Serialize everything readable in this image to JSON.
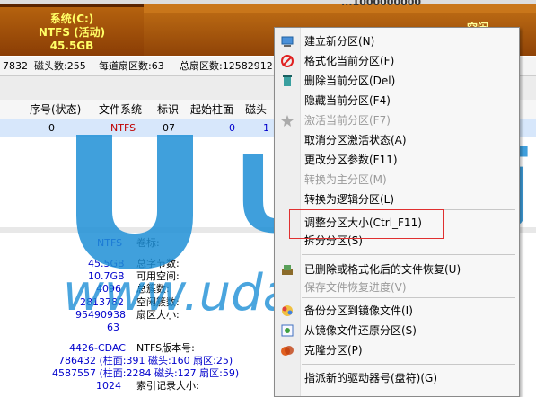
{
  "partition_bar": {
    "name": "系统(C:)",
    "fs": "NTFS (活动)",
    "size": "45.5GB",
    "second_label": "空闲"
  },
  "header_fragment": "...1000000000",
  "infobar": {
    "cyl_frag": "7832",
    "heads": "磁头数:255",
    "sectors_per_track": "每道扇区数:63",
    "total_sectors": "总扇区数:12582912"
  },
  "table": {
    "headers": [
      "序号(状态)",
      "文件系统",
      "标识",
      "起始柱面",
      "磁头"
    ],
    "row": {
      "index": "0",
      "fs": "NTFS",
      "id": "07",
      "start_cyl": "0",
      "head": "1"
    }
  },
  "details": {
    "fs_value": "NTFS",
    "fs_label": "卷标:",
    "total_size": "45.5GB",
    "total_bytes_label": "总字节数:",
    "free_space": "10.7GB",
    "free_label": "可用空间:",
    "cluster_size": "4096",
    "total_clusters_label": "总簇数:",
    "free_clusters": "2813782",
    "free_clusters_label": "空闲簇数:",
    "sector_count": "95490938",
    "sector_size_label": "扇区大小:",
    "sector_val": "63",
    "serial": "4426-CDAC",
    "ntfs_ver_label": "NTFS版本号:",
    "mft_pos": "786432 (柱面:391 磁头:160 扇区:25)",
    "mftmirr_pos": "4587557 (柱面:2284 磁头:127 扇区:59)",
    "last_frag": "1024",
    "index_label": "索引记录大小:"
  },
  "watermark_text": "U大师",
  "watermark_url": "www.udashi.com",
  "menu": {
    "items": [
      {
        "label": "建立新分区(N)",
        "icon": "new-partition-icon",
        "disabled": false
      },
      {
        "label": "格式化当前分区(F)",
        "icon": "format-icon",
        "disabled": false
      },
      {
        "label": "删除当前分区(Del)",
        "icon": "delete-icon",
        "disabled": false
      },
      {
        "label": "隐藏当前分区(F4)",
        "icon": "",
        "disabled": false
      },
      {
        "label": "激活当前分区(F7)",
        "icon": "activate-icon",
        "disabled": true
      },
      {
        "label": "取消分区激活状态(A)",
        "icon": "",
        "disabled": false
      },
      {
        "label": "更改分区参数(F11)",
        "icon": "",
        "disabled": false
      },
      {
        "label": "转换为主分区(M)",
        "icon": "",
        "disabled": true
      },
      {
        "label": "转换为逻辑分区(L)",
        "icon": "",
        "disabled": false
      },
      {
        "label": "调整分区大小(Ctrl_F11)",
        "icon": "",
        "disabled": false
      },
      {
        "label": "拆分分区(S)",
        "icon": "",
        "disabled": false
      },
      {
        "label": "已删除或格式化后的文件恢复(U)",
        "icon": "recover-icon",
        "disabled": false
      },
      {
        "label": "保存文件恢复进度(V)",
        "icon": "",
        "disabled": true
      },
      {
        "label": "备份分区到镜像文件(I)",
        "icon": "backup-icon",
        "disabled": false
      },
      {
        "label": "从镜像文件还原分区(S)",
        "icon": "restore-icon",
        "disabled": false
      },
      {
        "label": "克隆分区(P)",
        "icon": "clone-icon",
        "disabled": false
      },
      {
        "label": "指派新的驱动器号(盘符)(G)",
        "icon": "",
        "disabled": false
      }
    ]
  },
  "colors": {
    "partition": "#a0520a",
    "highlight_box": "#e03030",
    "watermark": "#1e8fd6"
  }
}
